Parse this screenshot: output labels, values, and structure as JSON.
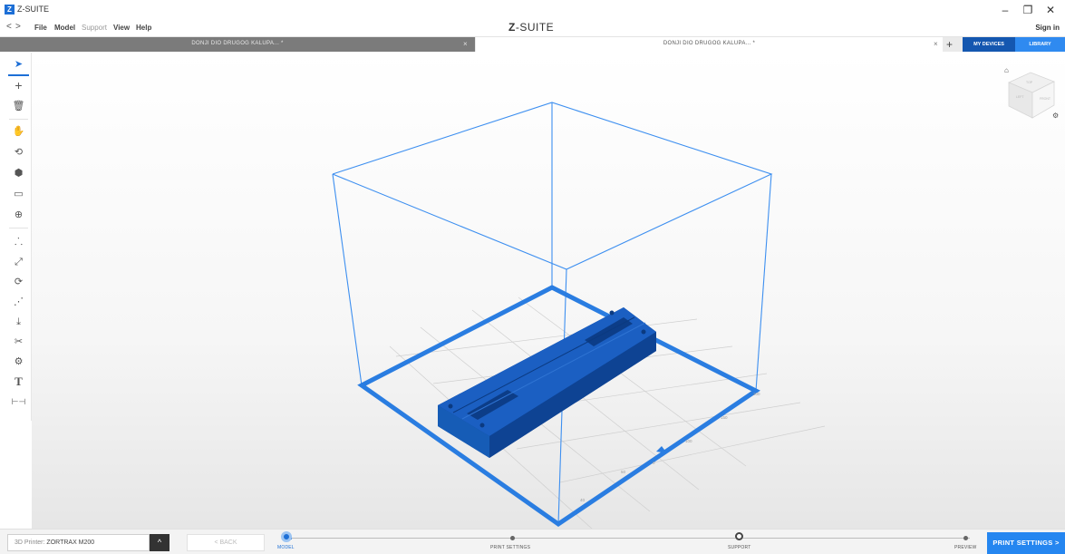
{
  "app": {
    "title": "Z-SUITE",
    "logo_letter": "Z",
    "brand_prefix": "Z",
    "brand_suffix": "-SUITE",
    "window_controls": [
      "–",
      "❐",
      "✕"
    ]
  },
  "menu": {
    "nav_back": "<",
    "nav_forward": ">",
    "items": [
      {
        "label": "File",
        "enabled": true
      },
      {
        "label": "Model",
        "enabled": true
      },
      {
        "label": "Support",
        "enabled": false
      },
      {
        "label": "View",
        "enabled": true
      },
      {
        "label": "Help",
        "enabled": true
      }
    ],
    "sign_in": "Sign in"
  },
  "tabs": [
    {
      "label": "DONJI DIO DRUGOG KALUPA... *",
      "active": false,
      "close": "×"
    },
    {
      "label": "DONJI DIO DRUGOG KALUPA... *",
      "active": true,
      "close": "×"
    }
  ],
  "tab_add": "+",
  "devices": {
    "my_devices": "MY DEVICES",
    "library": "LIBRARY"
  },
  "tools": [
    {
      "name": "select",
      "icon": "cursor-arrow-icon",
      "glyph": "➤",
      "active": true
    },
    {
      "name": "add",
      "icon": "plus-icon",
      "glyph": "+"
    },
    {
      "name": "delete",
      "icon": "trash-icon",
      "glyph": "🗑"
    },
    {
      "name": "pan",
      "icon": "hand-icon",
      "glyph": "✋"
    },
    {
      "name": "rotate-view",
      "icon": "rotate-view-icon",
      "glyph": "⟲"
    },
    {
      "name": "perspective",
      "icon": "cube-icon",
      "glyph": "⬢"
    },
    {
      "name": "camera",
      "icon": "camera-icon",
      "glyph": "▭"
    },
    {
      "name": "zoom",
      "icon": "zoom-icon",
      "glyph": "⊕"
    },
    {
      "name": "move",
      "icon": "move-icon",
      "glyph": "⸫"
    },
    {
      "name": "scale",
      "icon": "scale-icon",
      "glyph": "⤢"
    },
    {
      "name": "rotate",
      "icon": "rotate-icon",
      "glyph": "⟳"
    },
    {
      "name": "auto-arrange",
      "icon": "arrange-icon",
      "glyph": "⋰"
    },
    {
      "name": "place-face",
      "icon": "place-face-icon",
      "glyph": "⤓"
    },
    {
      "name": "cut",
      "icon": "scissors-icon",
      "glyph": "✂"
    },
    {
      "name": "repair",
      "icon": "repair-icon",
      "glyph": "⚙"
    },
    {
      "name": "text",
      "icon": "text-icon",
      "glyph": "T"
    },
    {
      "name": "measure",
      "icon": "measure-icon",
      "glyph": "⊢⊣"
    }
  ],
  "viewport": {
    "accent_color": "#2a7de1",
    "model_color": "#1457b0",
    "axis_ticks": [
      "200",
      "150",
      "100",
      "50",
      "0",
      "50",
      "40"
    ]
  },
  "viewcube": {
    "faces": [
      "TOP",
      "LEFT",
      "FRONT"
    ]
  },
  "footer": {
    "printer_prefix": "3D Printer:",
    "printer_name": "ZORTRAX M200",
    "printer_arrow": "^",
    "back_label": "< BACK",
    "steps": [
      {
        "label": "MODEL",
        "state": "current"
      },
      {
        "label": "PRINT SETTINGS",
        "state": "pending"
      },
      {
        "label": "SUPPORT",
        "state": "pending"
      },
      {
        "label": "PREVIEW",
        "state": "pending"
      }
    ],
    "next_label": "PRINT SETTINGS >"
  }
}
